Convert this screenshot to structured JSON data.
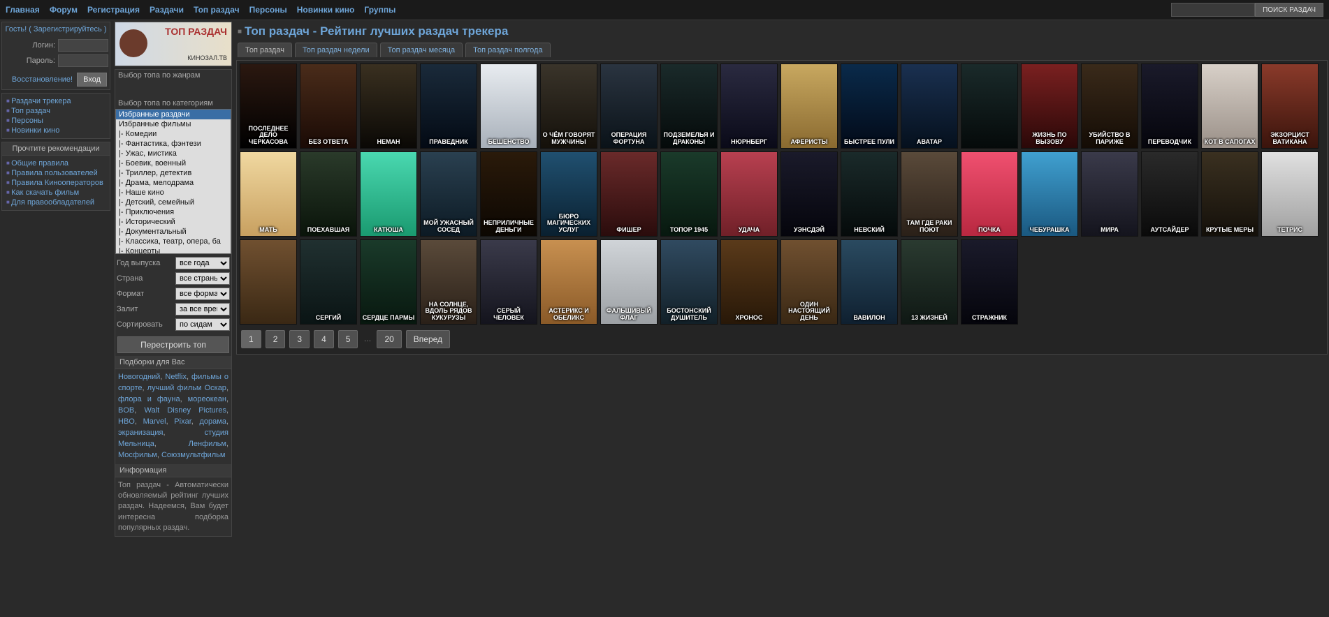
{
  "nav": {
    "items": [
      "Главная",
      "Форум",
      "Регистрация",
      "Раздачи",
      "Топ раздач",
      "Персоны",
      "Новинки кино",
      "Группы"
    ]
  },
  "search": {
    "button": "ПОИСК РАЗДАЧ"
  },
  "login": {
    "guest": "Гость! ( Зарегистрируйтесь )",
    "login_lbl": "Логин:",
    "pass_lbl": "Пароль:",
    "restore": "Восстановление!",
    "enter": "Вход"
  },
  "sidenav": {
    "items": [
      "Раздачи трекера",
      "Топ раздач",
      "Персоны",
      "Новинки кино"
    ]
  },
  "recs": {
    "head": "Прочтите рекомендации",
    "items": [
      "Общие правила",
      "Правила пользователей",
      "Правила Кинооператоров",
      "Как скачать фильм",
      "Для правообладателей"
    ]
  },
  "banner": {
    "title": "ТОП РАЗДАЧ",
    "sub": "КИНОЗАЛ.ТВ"
  },
  "filters": {
    "genre_lbl": "Выбор топа по жанрам",
    "cat_lbl": "Выбор топа по категориям",
    "cats": [
      "Избранные раздачи",
      "Избранные фильмы",
      "|- Комедии",
      "|- Фантастика, фэнтези",
      "|- Ужас, мистика",
      "|- Боевик, военный",
      "|- Триллер, детектив",
      "|- Драма, мелодрама",
      "|- Наше кино",
      "|- Детский, семейный",
      "|- Приключения",
      "|- Исторический",
      "|- Документальный",
      "|- Классика, театр, опера, ба",
      "|- Концерты"
    ],
    "year_lbl": "Год выпуска",
    "year_opt": "все года",
    "country_lbl": "Страна",
    "country_opt": "все страны",
    "format_lbl": "Формат",
    "format_opt": "все форматы",
    "upload_lbl": "Залит",
    "upload_opt": "за все время",
    "sort_lbl": "Сортировать",
    "sort_opt": "по сидам",
    "rebuild": "Перестроить топ"
  },
  "collections": {
    "head": "Подборки для Вас",
    "tags": [
      "Новогодний",
      "Netflix",
      "фильмы о спорте",
      "лучший фильм Оскар",
      "флора и фауна",
      "мореокеан",
      "BOB",
      "Walt Disney Pictures",
      "HBO",
      "Marvel",
      "Pixar",
      "дорама",
      "экранизация",
      "студия Мельница",
      "Ленфильм",
      "Мосфильм",
      "Союзмультфильм"
    ]
  },
  "info": {
    "head": "Информация",
    "text": "Топ раздач - Автоматически обновляемый рейтинг лучших раздач. Надеемся, Вам будет интересна подборка популярных раздач."
  },
  "page": {
    "title": "Топ раздач - Рейтинг лучших раздач трекера"
  },
  "tabs": [
    "Топ раздач",
    "Топ раздач недели",
    "Топ раздач месяца",
    "Топ раздач полгода"
  ],
  "posters": [
    {
      "t": "ПОСЛЕДНЕЕ ДЕЛО ЧЕРКАСОВА",
      "v": 0
    },
    {
      "t": "БЕЗ ОТВЕТА",
      "v": 1
    },
    {
      "t": "НЕМАН",
      "v": 2
    },
    {
      "t": "ПРАВЕДНИК",
      "v": 3
    },
    {
      "t": "БЕШЕНСТВО",
      "v": 4
    },
    {
      "t": "О ЧЁМ ГОВОРЯТ МУЖЧИНЫ",
      "v": 5
    },
    {
      "t": "ОПЕРАЦИЯ ФОРТУНА",
      "v": 6
    },
    {
      "t": "ПОДЗЕМЕЛЬЯ И ДРАКОНЫ",
      "v": 7
    },
    {
      "t": "НЮРНБЕРГ",
      "v": 8
    },
    {
      "t": "АФЕРИСТЫ",
      "v": 9
    },
    {
      "t": "БЫСТРЕЕ ПУЛИ",
      "v": 10
    },
    {
      "t": "АВАТАР",
      "v": 11
    },
    {
      "t": "",
      "v": 7
    },
    {
      "t": "ЖИЗНЬ ПО ВЫЗОВУ",
      "v": 12
    },
    {
      "t": "УБИЙСТВО В ПАРИЖЕ",
      "v": 13
    },
    {
      "t": "ПЕРЕВОДЧИК",
      "v": 14
    },
    {
      "t": "КОТ В САПОГАХ",
      "v": 15
    },
    {
      "t": "ЭКЗОРЦИСТ ВАТИКАНА",
      "v": 16
    },
    {
      "t": "МАТЬ",
      "v": 17
    },
    {
      "t": "ПОЕХАВШАЯ",
      "v": 18
    },
    {
      "t": "КАТЮША",
      "v": 19
    },
    {
      "t": "МОЙ УЖАСНЫЙ СОСЕД",
      "v": 20
    },
    {
      "t": "НЕПРИЛИЧНЫЕ ДЕНЬГИ",
      "v": 21
    },
    {
      "t": "БЮРО МАГИЧЕСКИХ УСЛУГ",
      "v": 22
    },
    {
      "t": "ФИШЕР",
      "v": 23
    },
    {
      "t": "ТОПОР 1945",
      "v": 32
    },
    {
      "t": "УДАЧА",
      "v": 24
    },
    {
      "t": "УЭНСДЭЙ",
      "v": 14
    },
    {
      "t": "НЕВСКИЙ",
      "v": 7
    },
    {
      "t": "ТАМ ГДЕ РАКИ ПОЮТ",
      "v": 33
    },
    {
      "t": "ПОЧКА",
      "v": 25
    },
    {
      "t": "ЧЕБУРАШКА",
      "v": 26
    },
    {
      "t": "МИРА",
      "v": 27
    },
    {
      "t": "АУТСАЙДЕР",
      "v": 28
    },
    {
      "t": "КРУТЫЕ МЕРЫ",
      "v": 29
    },
    {
      "t": "ТЕТРИС",
      "v": 30
    },
    {
      "t": "",
      "v": 38
    },
    {
      "t": "СЕРГИЙ",
      "v": 31
    },
    {
      "t": "СЕРДЦЕ ПАРМЫ",
      "v": 32
    },
    {
      "t": "НА СОЛНЦЕ, ВДОЛЬ РЯДОВ КУКУРУЗЫ",
      "v": 33
    },
    {
      "t": "СЕРЫЙ ЧЕЛОВЕК",
      "v": 27
    },
    {
      "t": "АСТЕРИКС И ОБЕЛИКС",
      "v": 34
    },
    {
      "t": "ФАЛЬШИВЫЙ ФЛАГ",
      "v": 35
    },
    {
      "t": "БОСТОНСКИЙ ДУШИТЕЛЬ",
      "v": 36
    },
    {
      "t": "ХРОНОС",
      "v": 37
    },
    {
      "t": "ОДИН НАСТОЯЩИЙ ДЕНЬ",
      "v": 38
    },
    {
      "t": "ВАВИЛОН",
      "v": 39
    },
    {
      "t": "13 ЖИЗНЕЙ",
      "v": 44
    },
    {
      "t": "СТРАЖНИК",
      "v": 14
    }
  ],
  "pager": {
    "pages": [
      "1",
      "2",
      "3",
      "4",
      "5"
    ],
    "last": "20",
    "next": "Вперед",
    "dots": "…"
  }
}
